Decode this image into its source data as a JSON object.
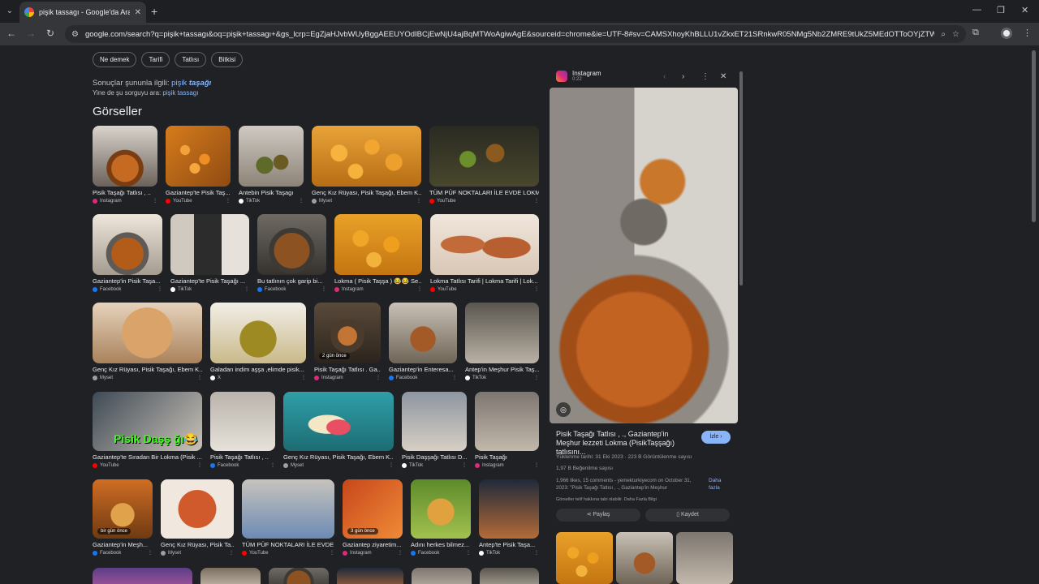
{
  "browser": {
    "tab_title": "pişik tassagı - Google'da Ara",
    "url": "google.com/search?q=pişik+tassagı&oq=pişik+tassagı+&gs_lcrp=EgZjaHJvbWUyBggAEEUYOdIBCjEwNjU4ajBqMTWoAgiwAgE&sourceid=chrome&ie=UTF-8#sv=CAMSXhoyKhBLLU1vZkxET21SRnkwR05NMg5Nb2ZMRE9tUkZ5MEdOTToOYjZTWWE0Z..."
  },
  "filters": [
    "Ne demek",
    "Tarifi",
    "Tatlısı",
    "Bitkisi"
  ],
  "correction": {
    "prefix": "Sonuçlar şununla ilgili: ",
    "plain": "pişik ",
    "emph": "taşağı",
    "alt_prefix": "Yine de şu sorguyu ara: ",
    "alt_link": "pişik tassagı"
  },
  "section_title": "Görseller",
  "images": [
    {
      "caption": "Pisik Taşağı Tatlısı , ..",
      "source": "Instagram",
      "source_color": "#dd2a7b"
    },
    {
      "caption": "Gaziantep'te Pisik Taş...",
      "source": "YouTube",
      "source_color": "#ff0000"
    },
    {
      "caption": "Antebin Pisik Taşagı",
      "source": "TikTok",
      "source_color": "#ffffff"
    },
    {
      "caption": "Genç Kız Rüyası, Pisik Taşağı, Ebem K...",
      "source": "Myset",
      "source_color": "#9aa0a6"
    },
    {
      "caption": "TÜM PÜF NOKTALARI İLE EVDE LOKM...",
      "source": "YouTube",
      "source_color": "#ff0000"
    },
    {
      "caption": "Gaziantep'in Pisik Taşa...",
      "source": "Facebook",
      "source_color": "#1877f2"
    },
    {
      "caption": "Gaziantep'te Pisik Taşağı ...",
      "source": "TikTok",
      "source_color": "#ffffff"
    },
    {
      "caption": "Bu tatlının çok garip bi...",
      "source": "Facebook",
      "source_color": "#1877f2"
    },
    {
      "caption": "Lokma ( Pisik Taşşa ) 😂😂 Se...",
      "source": "Instagram",
      "source_color": "#dd2a7b"
    },
    {
      "caption": "Lokma Tatlısı Tarifi | Lokma Tarifi | Lok...",
      "source": "YouTube",
      "source_color": "#ff0000"
    },
    {
      "caption": "Genç Kız Rüyası, Pisik Taşağı, Ebem K...",
      "source": "Myset",
      "source_color": "#9aa0a6"
    },
    {
      "caption": "Galadan indim aşşa ,elimde pisik...",
      "source": "X",
      "source_color": "#ffffff"
    },
    {
      "caption": "Pisik Taşağı Tatlısı . Ga...",
      "source": "Instagram",
      "source_color": "#dd2a7b",
      "badge": "2 gün önce"
    },
    {
      "caption": "Gaziantep'in Enteresa...",
      "source": "Facebook",
      "source_color": "#1877f2"
    },
    {
      "caption": "Antep'in Meşhur Pisik Taş...",
      "source": "TikTok",
      "source_color": "#ffffff"
    },
    {
      "caption": "Gaziantep'te Sıradan Bir Lokma (Pisik ...",
      "source": "YouTube",
      "source_color": "#ff0000",
      "overlay": "Pisik Daşş ğı😂"
    },
    {
      "caption": "Pisik Taşağı Tatlısı , ..",
      "source": "Facebook",
      "source_color": "#1877f2"
    },
    {
      "caption": "Genç Kız Rüyası, Pisik Taşağı, Ebem K...",
      "source": "Myset",
      "source_color": "#9aa0a6"
    },
    {
      "caption": "Pisik Daşşağı Tatlısı D...",
      "source": "TikTok",
      "source_color": "#ffffff"
    },
    {
      "caption": "Pisik Taşağı",
      "source": "Instagram",
      "source_color": "#dd2a7b"
    },
    {
      "caption": "Gaziantep'in Meşh...",
      "source": "Facebook",
      "source_color": "#1877f2",
      "badge": "bir gün önce"
    },
    {
      "caption": "Genç Kız Rüyası, Pisik Ta...",
      "source": "Myset",
      "source_color": "#9aa0a6"
    },
    {
      "caption": "TÜM PÜF NOKTALARI İLE EVDE ...",
      "source": "YouTube",
      "source_color": "#ff0000"
    },
    {
      "caption": "Gaziantep ziyaretim...",
      "source": "Instagram",
      "source_color": "#dd2a7b",
      "badge": "3 gün önce"
    },
    {
      "caption": "Adını herkes bilmez...",
      "source": "Facebook",
      "source_color": "#1877f2"
    },
    {
      "caption": "Antep'te Pisik Taşa...",
      "source": "TikTok",
      "source_color": "#ffffff"
    }
  ],
  "panel": {
    "source": "Instagram",
    "duration": "0:22",
    "title": "Pisik Taşağı Tatlısı , ., Gaziantep'in Meşhur lezzeti Lokma (PisikTaşşağı) tatlısını...",
    "visit_label": "İzle",
    "meta_date": "Yüklenme tarihi: 31 Eki 2023 · 223 B Görüntülenme sayısı",
    "meta_likes": "1,97 B Beğenilme sayısı",
    "meta_desc": "1,966 likes, 15 comments - yemekturkiyecom on October 31, 2023: \"Pisik Taşağı Tatlısı , ., Gaziantep'in Meşhur",
    "meta_copyright": "Görseller telif hakkına tabi olabilir. Daha Fazla Bilgi",
    "more_label": "Daha fazla",
    "share_label": "Paylaş",
    "save_label": "Kaydet"
  }
}
